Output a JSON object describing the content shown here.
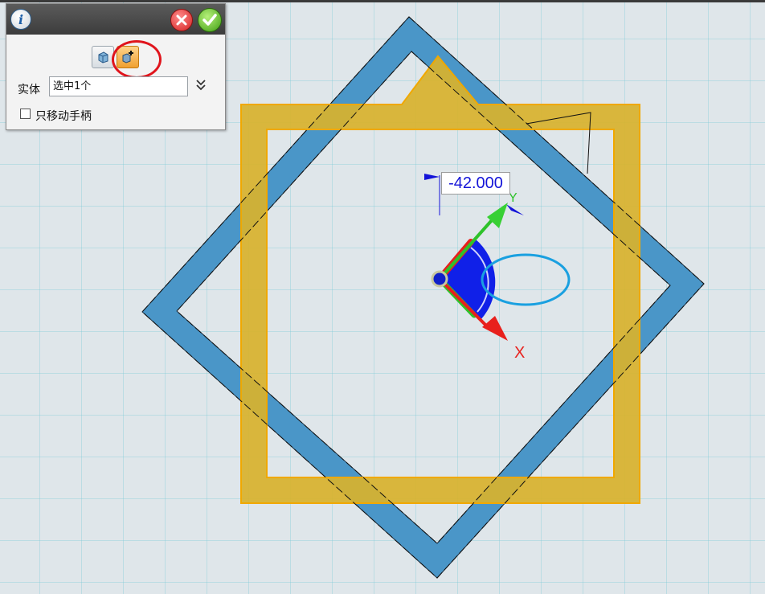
{
  "panel": {
    "entity_label": "实体",
    "entity_value": "选中1个",
    "move_handle_only_label": "只移动手柄",
    "move_handle_only_checked": false,
    "icons": {
      "info": "info-icon",
      "cancel": "cancel-icon",
      "confirm": "checkmark-icon",
      "move_entity": "move-entity-icon",
      "move_handle": "move-handle-icon",
      "expand": "double-chevron-down-icon"
    }
  },
  "canvas": {
    "angle_value": "-42.000",
    "x_axis_label": "X",
    "y_axis_label": "Y"
  },
  "colors": {
    "blue_part": "#4a96c8",
    "yellow_part": "#d8b22c",
    "x_axis": "#e8201c",
    "y_axis": "#2ec22a",
    "rotation_arc": "#1020e8",
    "annotation_red": "#e0141c",
    "annotation_cyan": "#1aa0e0"
  }
}
